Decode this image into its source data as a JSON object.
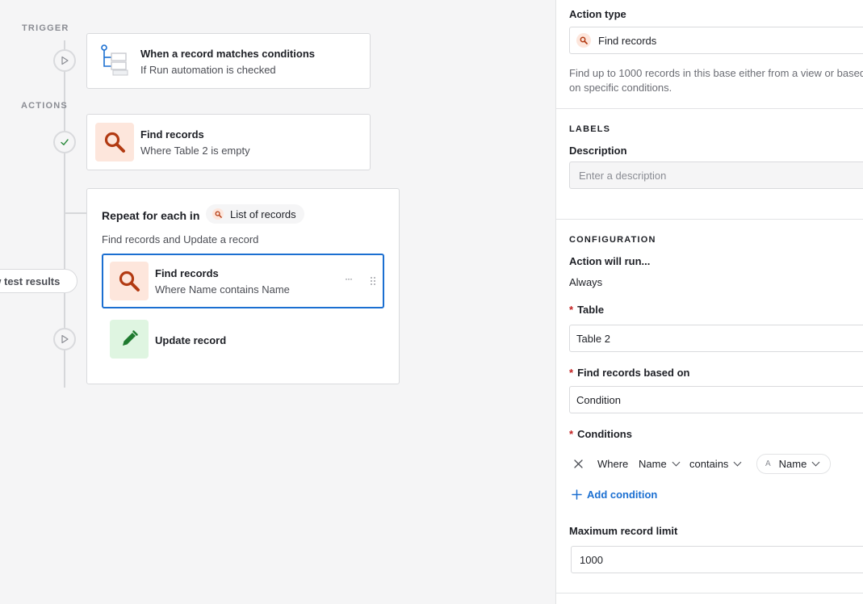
{
  "canvas": {
    "trigger_label": "TRIGGER",
    "actions_label": "ACTIONS",
    "trigger_card": {
      "title": "When a record matches conditions",
      "subtitle": "If Run automation is checked"
    },
    "find_card": {
      "title": "Find records",
      "subtitle": "Where Table 2 is empty"
    },
    "repeat": {
      "title": "Repeat for each in",
      "list_pill": "List of records",
      "subtitle": "Find records and Update a record",
      "inner_find": {
        "title": "Find records",
        "subtitle": "Where Name contains Name",
        "more": "···"
      },
      "update": {
        "title": "Update record"
      }
    },
    "test_button": "View test results"
  },
  "panel": {
    "action_type_label": "Action type",
    "action_type_value": "Find records",
    "action_type_desc": "Find up to 1000 records in this base either from a view or based on specific conditions.",
    "labels_section": "LABELS",
    "description_label": "Description",
    "description_placeholder": "Enter a description",
    "config_section": "CONFIGURATION",
    "action_will_run_label": "Action will run...",
    "action_will_run_value": "Always",
    "table_label": "Table",
    "table_value": "Table 2",
    "based_on_label": "Find records based on",
    "based_on_value": "Condition",
    "conditions_label": "Conditions",
    "condition": {
      "where": "Where",
      "field": "Name",
      "operator": "contains",
      "value": "Name"
    },
    "add_condition": "Add condition",
    "max_limit_label": "Maximum record limit",
    "max_limit_value": "1000",
    "required_mark": "*"
  },
  "colors": {
    "accent_blue": "#1b6fd1",
    "find_tile": "#fde6dc",
    "find_icon": "#b23a12",
    "update_tile": "#dff5e1",
    "update_icon": "#1f7a2f",
    "required": "#c22020"
  }
}
